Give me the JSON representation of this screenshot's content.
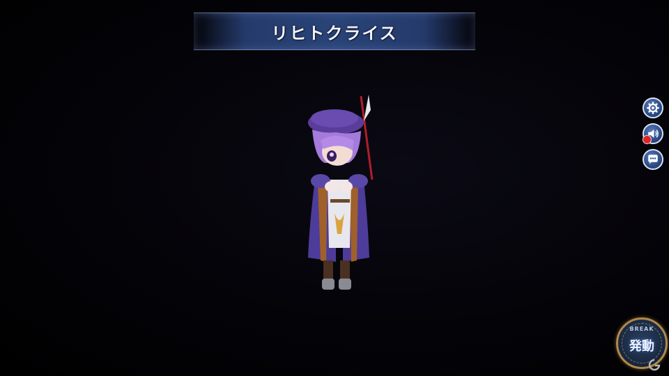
{
  "header": {
    "character_name": "リヒトクライス"
  },
  "side_menu": {
    "settings_icon": "gear-icon",
    "sound_icon": "speaker-icon",
    "sound_muted": true,
    "chat_icon": "chat-bubble-icon"
  },
  "burst": {
    "label": "BREAK",
    "button_text": "発動"
  },
  "colors": {
    "banner": "#2a4478",
    "button_fill": "#2a4a86",
    "badge_rim": "#b08a4a",
    "mute_indicator": "#d8262a"
  }
}
